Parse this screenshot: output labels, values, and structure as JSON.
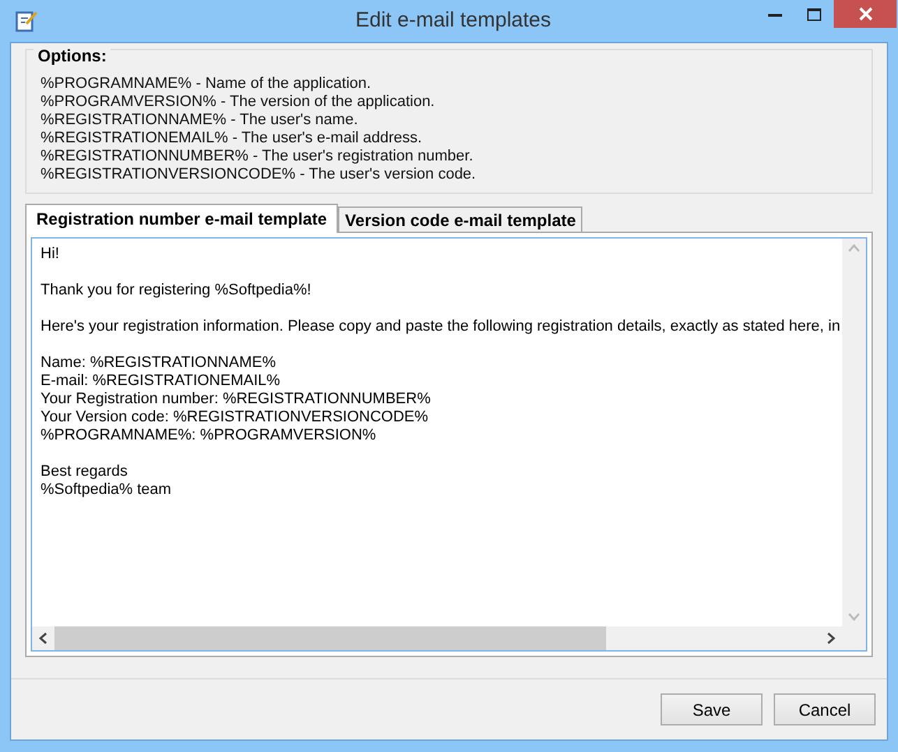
{
  "window": {
    "title": "Edit e-mail templates"
  },
  "options": {
    "title": "Options:",
    "lines": [
      "%PROGRAMNAME% - Name of the application.",
      "%PROGRAMVERSION% - The version of the application.",
      "%REGISTRATIONNAME% - The user's name.",
      "%REGISTRATIONEMAIL% - The user's e-mail address.",
      "%REGISTRATIONNUMBER% - The user's registration number.",
      "%REGISTRATIONVERSIONCODE% - The user's version code."
    ]
  },
  "tabs": [
    {
      "label": "Registration number e-mail template",
      "selected": true
    },
    {
      "label": "Version code e-mail template",
      "selected": false
    }
  ],
  "editor": {
    "paragraphs": [
      [
        "Hi!"
      ],
      [
        "Thank you for registering %Softpedia%!"
      ],
      [
        "Here's your registration information. Please copy and paste the following registration details, exactly as stated here, in"
      ],
      [
        "Name: %REGISTRATIONNAME%",
        "E-mail: %REGISTRATIONEMAIL%",
        "Your Registration number: %REGISTRATIONNUMBER%",
        "Your Version code: %REGISTRATIONVERSIONCODE%",
        "%PROGRAMNAME%: %PROGRAMVERSION%"
      ],
      [
        "Best regards",
        "%Softpedia% team"
      ]
    ]
  },
  "buttons": [
    "Save",
    "Cancel"
  ]
}
